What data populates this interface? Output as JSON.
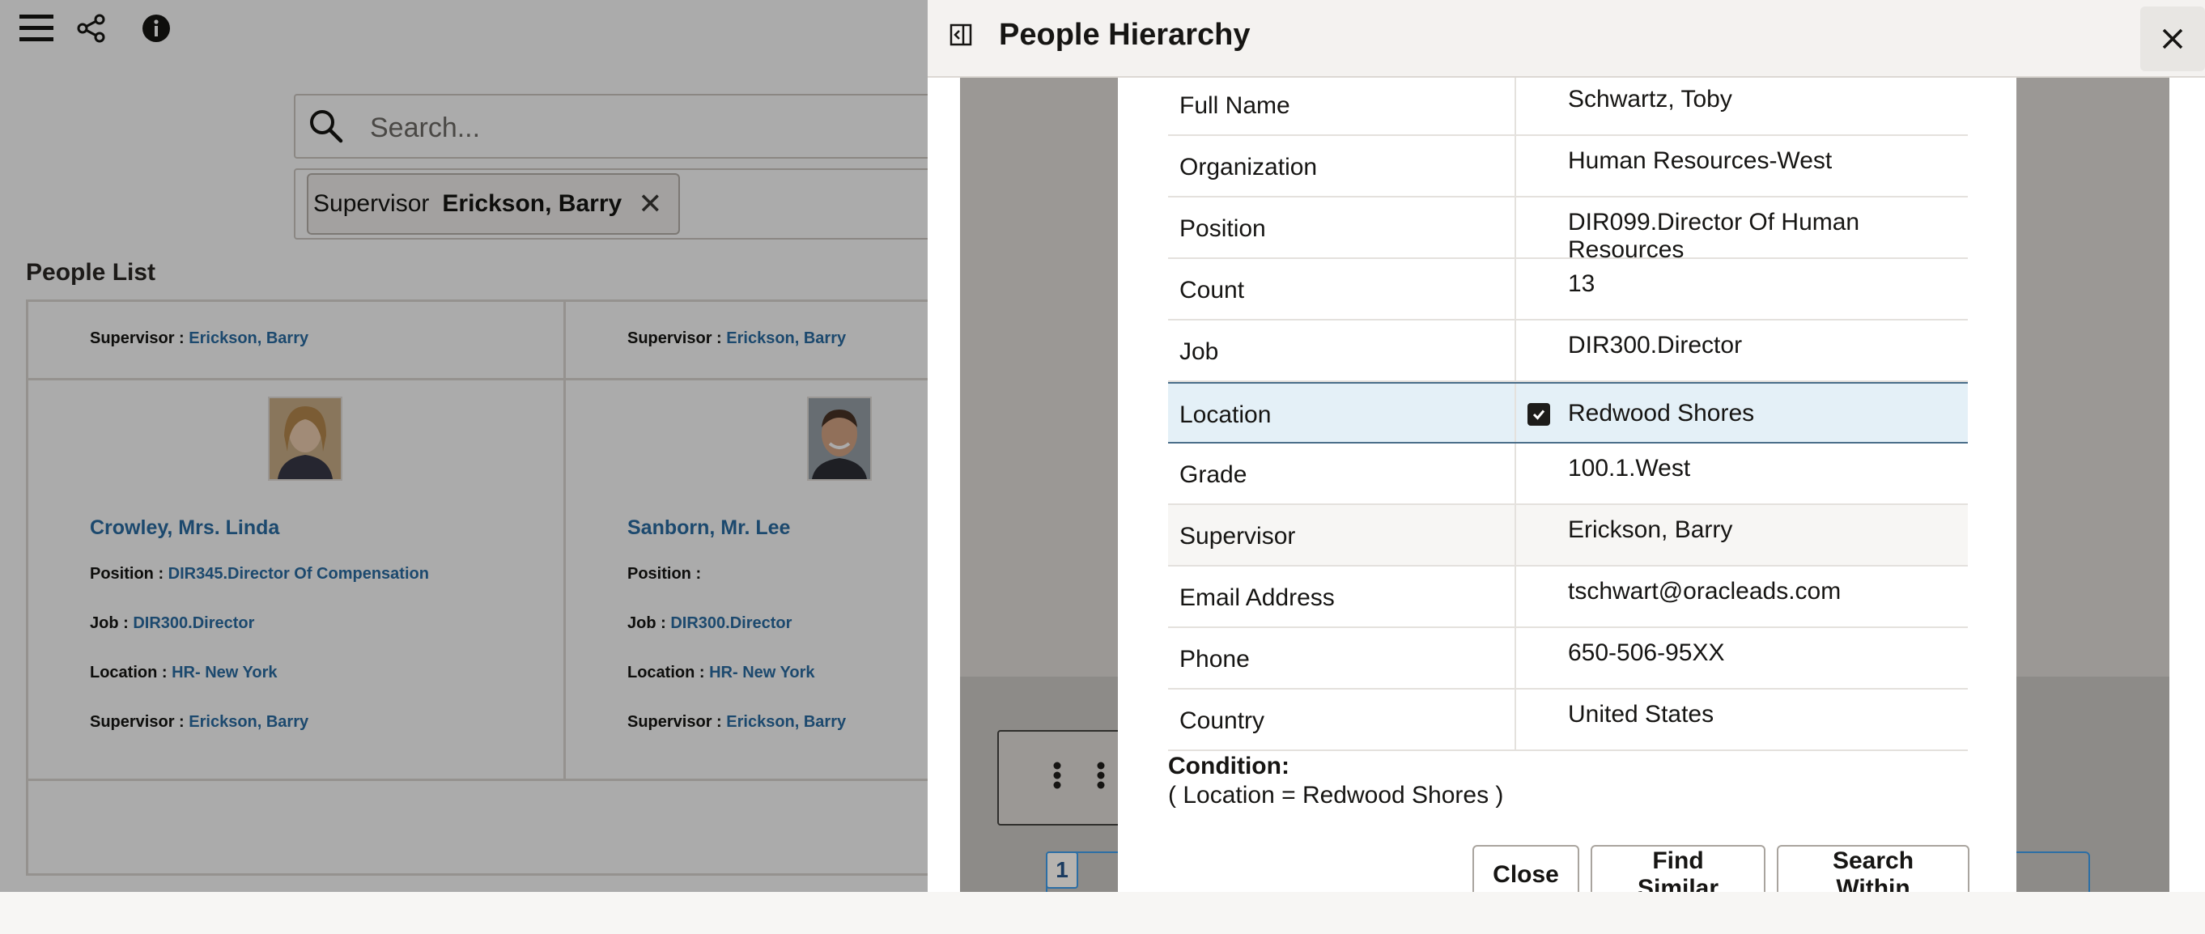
{
  "toolbar": {
    "menu_icon": "hamburger-icon",
    "share_icon": "share-icon",
    "info_icon": "info-icon"
  },
  "search": {
    "placeholder": "Search..."
  },
  "filter_chip": {
    "label": "Supervisor",
    "value": "Erickson, Barry"
  },
  "people_list": {
    "title": "People List",
    "labels": {
      "position": "Position :",
      "job": "Job :",
      "location": "Location :",
      "supervisor": "Supervisor :"
    },
    "top_row": [
      {
        "supervisor": "Erickson, Barry"
      },
      {
        "supervisor": "Erickson, Barry"
      }
    ],
    "cards": [
      {
        "name": "Crowley, Mrs. Linda",
        "position": "DIR345.Director Of Compensation",
        "job": "DIR300.Director",
        "location": "HR- New York",
        "supervisor": "Erickson, Barry"
      },
      {
        "name": "Sanborn, Mr. Lee",
        "position": "",
        "job": "DIR300.Director",
        "location": "HR- New York",
        "supervisor": "Erickson, Barry"
      }
    ]
  },
  "drawer": {
    "title": "People Hierarchy",
    "collapse_icon": "panel-collapse-icon",
    "close_icon": "close-icon",
    "page_number": "1"
  },
  "detail": {
    "rows": [
      {
        "label": "Full Name",
        "value": "Schwartz, Toby"
      },
      {
        "label": "Organization",
        "value": "Human Resources-West"
      },
      {
        "label": "Position",
        "value": "DIR099.Director Of Human Resources"
      },
      {
        "label": "Count",
        "value": "13"
      },
      {
        "label": "Job",
        "value": "DIR300.Director"
      },
      {
        "label": "Location",
        "value": "Redwood Shores",
        "checked": true
      },
      {
        "label": "Grade",
        "value": "100.1.West"
      },
      {
        "label": "Supervisor",
        "value": "Erickson, Barry"
      },
      {
        "label": "Email Address",
        "value": "tschwart@oracleads.com"
      },
      {
        "label": "Phone",
        "value": "650-506-95XX"
      },
      {
        "label": "Country",
        "value": "United States"
      }
    ],
    "condition_label": "Condition:",
    "condition_text": "( Location = Redwood Shores )",
    "buttons": {
      "close": "Close",
      "find_similar": "Find Similar",
      "search_within": "Search Within"
    }
  },
  "colors": {
    "link": "#2b6ea5",
    "selected_row": "#e4f0f7"
  }
}
